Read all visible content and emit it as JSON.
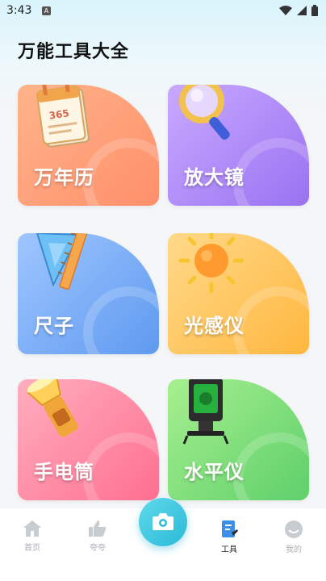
{
  "status_bar": {
    "time": "3:43",
    "notification_badge": "A"
  },
  "header": {
    "title": "万能工具大全"
  },
  "tools": [
    {
      "label": "万年历",
      "icon": "calendar-icon",
      "calendar_number": "365",
      "color": "#ff9a74"
    },
    {
      "label": "放大镜",
      "icon": "magnifier-icon",
      "color": "#a880f6"
    },
    {
      "label": "尺子",
      "icon": "ruler-icon",
      "color": "#6aa3f2"
    },
    {
      "label": "光感仪",
      "icon": "sun-icon",
      "color": "#ffbe4b"
    },
    {
      "label": "手电筒",
      "icon": "flashlight-icon",
      "color": "#ff7a97"
    },
    {
      "label": "水平仪",
      "icon": "laser-level-icon",
      "color": "#66d46f"
    }
  ],
  "bottom_nav": {
    "items": [
      {
        "label": "首页",
        "icon": "home-icon"
      },
      {
        "label": "夸夸",
        "icon": "thumbs-up-icon"
      },
      {
        "label": "工具",
        "icon": "tools-icon",
        "active": true
      },
      {
        "label": "我的",
        "icon": "profile-icon"
      }
    ],
    "center_button_icon": "camera-icon"
  }
}
